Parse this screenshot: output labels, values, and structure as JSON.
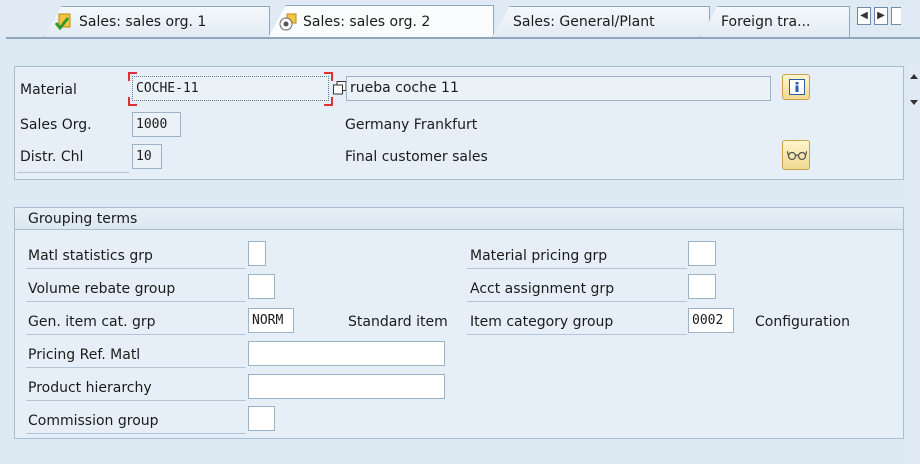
{
  "tabs": [
    {
      "label": "Sales: sales org. 1",
      "icon": "check-document-icon"
    },
    {
      "label": "Sales: sales org. 2",
      "icon": "target-document-icon",
      "active": true
    },
    {
      "label": "Sales: General/Plant"
    },
    {
      "label": "Foreign tra..."
    }
  ],
  "tab_scroll": {
    "left": "◀",
    "right": "▶"
  },
  "header": {
    "material_label": "Material",
    "material_value": "COCHE-11",
    "material_desc": "rueba coche 11",
    "salesorg_label": "Sales Org.",
    "salesorg_value": "1000",
    "salesorg_desc": "Germany Frankfurt",
    "distr_label": "Distr. Chl",
    "distr_value": "10",
    "distr_desc": "Final customer sales"
  },
  "grouping": {
    "title": "Grouping terms",
    "left": [
      {
        "label": "Matl statistics grp",
        "value": ""
      },
      {
        "label": "Volume rebate group",
        "value": ""
      },
      {
        "label": "Gen. item cat. grp",
        "value": "NORM",
        "desc": "Standard item"
      },
      {
        "label": "Pricing Ref. Matl",
        "value": ""
      },
      {
        "label": "Product hierarchy",
        "value": ""
      },
      {
        "label": "Commission group",
        "value": ""
      }
    ],
    "right": [
      {
        "label": "Material pricing grp",
        "value": ""
      },
      {
        "label": "Acct assignment grp",
        "value": ""
      },
      {
        "label": "Item category group",
        "value": "0002",
        "desc": "Configuration"
      }
    ]
  },
  "colors": {
    "accent": "#c8a24a",
    "focus_marker": "#d33333",
    "panel": "#e6eff7"
  }
}
